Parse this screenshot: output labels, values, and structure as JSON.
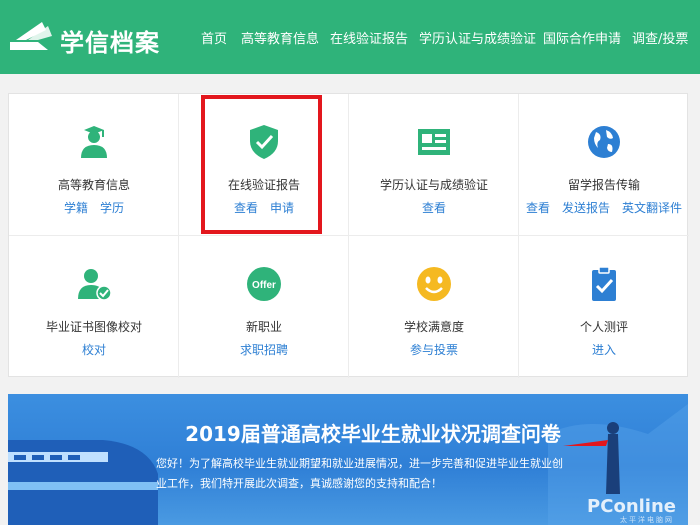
{
  "header": {
    "logo_text": "学信档案",
    "nav": [
      "首页",
      "高等教育信息",
      "在线验证报告",
      "学历认证与成绩验证",
      "国际合作申请",
      "调查/投票"
    ],
    "bg_color": "#2fb37a"
  },
  "services": [
    {
      "title": "高等教育信息",
      "links": [
        "学籍",
        "学历"
      ],
      "icon": "graduate-icon"
    },
    {
      "title": "在线验证报告",
      "links": [
        "查看",
        "申请"
      ],
      "icon": "shield-check-icon"
    },
    {
      "title": "学历认证与成绩验证",
      "links": [
        "查看"
      ],
      "icon": "certificate-icon"
    },
    {
      "title": "留学报告传输",
      "links": [
        "查看",
        "发送报告",
        "英文翻译件"
      ],
      "icon": "globe-icon"
    },
    {
      "title": "毕业证书图像校对",
      "links": [
        "校对"
      ],
      "icon": "user-check-icon"
    },
    {
      "title": "新职业",
      "links": [
        "求职招聘"
      ],
      "icon": "offer-icon"
    },
    {
      "title": "学校满意度",
      "links": [
        "参与投票"
      ],
      "icon": "smiley-icon"
    },
    {
      "title": "个人测评",
      "links": [
        "进入"
      ],
      "icon": "clipboard-check-icon"
    }
  ],
  "offer_icon_text": "Offer",
  "banner": {
    "title": "2019届普通高校毕业生就业状况调查问卷",
    "text": "您好！为了解高校毕业生就业期望和就业进展情况，进一步完善和促进毕业生就业创业工作，我们特开展此次调查，真诚感谢您的支持和配合！"
  },
  "watermark": {
    "text": "PConline",
    "sub": "太平洋电脑网"
  }
}
